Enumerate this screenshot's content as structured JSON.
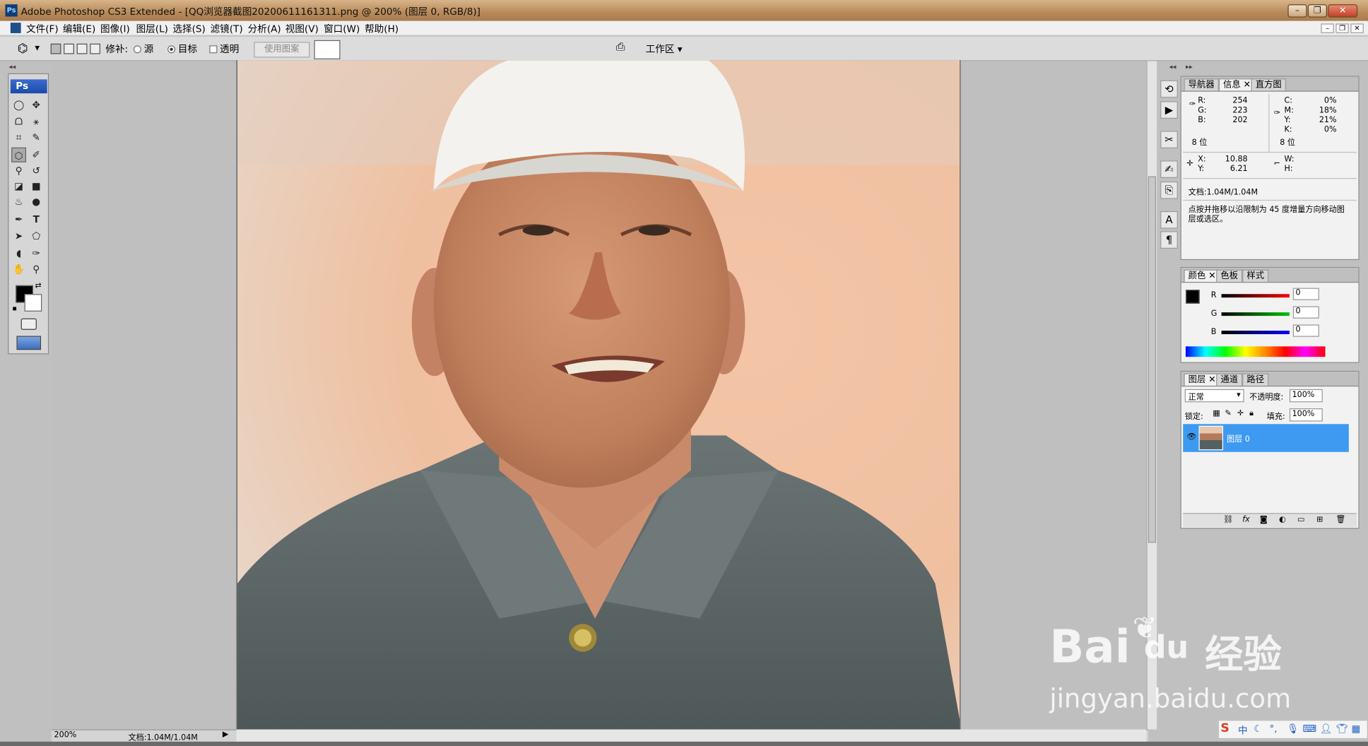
{
  "window": {
    "title": "Adobe Photoshop CS3 Extended - [QQ浏览器截图20200611161311.png @ 200% (图层 0, RGB/8)]",
    "app_badge": "Ps",
    "buttons": {
      "minimize": "–",
      "restore": "❐",
      "close": "✕"
    }
  },
  "menu": [
    "文件(F)",
    "编辑(E)",
    "图像(I)",
    "图层(L)",
    "选择(S)",
    "滤镜(T)",
    "分析(A)",
    "视图(V)",
    "窗口(W)",
    "帮助(H)"
  ],
  "options": {
    "patch_label": "修补:",
    "source_label": "源",
    "target_label": "目标",
    "transparent_label": "透明",
    "use_pattern_label": "使用图案",
    "workspace_label": "工作区"
  },
  "toolbox": {
    "header": "Ps"
  },
  "status": {
    "zoom": "200%",
    "doc": "文档:1.04M/1.04M"
  },
  "info_panel": {
    "tabs": [
      "导航器",
      "信息",
      "直方图"
    ],
    "active_tab": "信息",
    "rgb": {
      "R": "254",
      "G": "223",
      "B": "202"
    },
    "cmyk": {
      "C": "0%",
      "M": "18%",
      "Y": "21%",
      "K": "0%"
    },
    "bits_left": "8 位",
    "bits_right": "8 位",
    "x_label": "X:",
    "x_value": "10.88",
    "y_label": "Y:",
    "y_value": "6.21",
    "w_label": "W:",
    "h_label": "H:",
    "doc": "文档:1.04M/1.04M",
    "hint": "点按并拖移以沿限制为 45 度增量方向移动图层或选区。"
  },
  "color_panel": {
    "tabs": [
      "颜色",
      "色板",
      "样式"
    ],
    "active_tab": "颜色",
    "channels": [
      {
        "label": "R",
        "value": "0",
        "color": "#d00000"
      },
      {
        "label": "G",
        "value": "0",
        "color": "#00a000"
      },
      {
        "label": "B",
        "value": "0",
        "color": "#0000d0"
      }
    ]
  },
  "layers_panel": {
    "tabs": [
      "图层",
      "通道",
      "路径"
    ],
    "active_tab": "图层",
    "blend_mode": "正常",
    "opacity_label": "不透明度:",
    "opacity_value": "100%",
    "lock_label": "锁定:",
    "fill_label": "填充:",
    "fill_value": "100%",
    "layers": [
      {
        "name": "图层 0",
        "selected": true
      }
    ]
  },
  "watermark": {
    "brand": "Bai",
    "brand2": "du",
    "cn": "经验",
    "url": "jingyan.baidu.com"
  },
  "tray": {
    "ime": "中"
  }
}
